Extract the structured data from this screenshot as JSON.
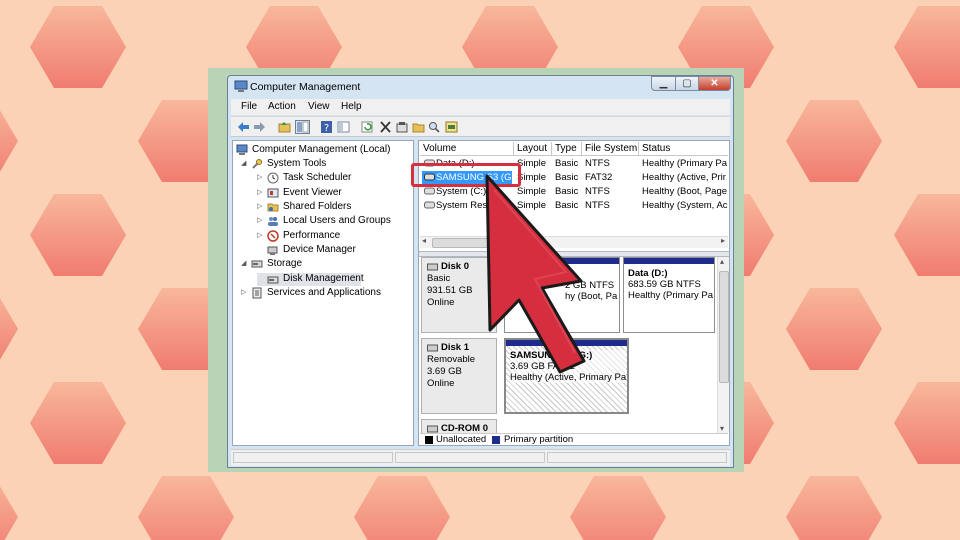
{
  "window": {
    "title": "Computer Management"
  },
  "menu": [
    "File",
    "Action",
    "View",
    "Help"
  ],
  "tree": {
    "root": "Computer Management (Local)",
    "system_tools": "System Tools",
    "items": [
      "Task Scheduler",
      "Event Viewer",
      "Shared Folders",
      "Local Users and Groups",
      "Performance",
      "Device Manager"
    ],
    "storage": "Storage",
    "disk_management": "Disk Management",
    "services": "Services and Applications"
  },
  "volume_table": {
    "columns": [
      "Volume",
      "Layout",
      "Type",
      "File System",
      "Status"
    ],
    "rows": [
      [
        "Data (D:)",
        "Simple",
        "Basic",
        "NTFS",
        "Healthy (Primary Pa"
      ],
      [
        "SAMSUNG S3 (G:)",
        "Simple",
        "Basic",
        "FAT32",
        "Healthy (Active, Prir"
      ],
      [
        "System (C:)",
        "Simple",
        "Basic",
        "NTFS",
        "Healthy (Boot, Page"
      ],
      [
        "System Rese",
        "Simple",
        "Basic",
        "NTFS",
        "Healthy (System, Ac"
      ]
    ]
  },
  "disks": {
    "disk0": {
      "name": "Disk 0",
      "type": "Basic",
      "size": "931.51 GB",
      "state": "Online"
    },
    "disk0_c": {
      "size": "2 GB NTFS",
      "status": "hy (Boot, Pa"
    },
    "disk0_d": {
      "name": "Data  (D:)",
      "size": "683.59 GB NTFS",
      "status": "Healthy (Primary Pa"
    },
    "disk1": {
      "name": "Disk 1",
      "type": "Removable",
      "size": "3.69 GB",
      "state": "Online"
    },
    "disk1_g": {
      "name": "SAMSUNG S3 (G:)",
      "size": "3.69 GB FAT32",
      "status": "Healthy (Active, Primary Pa"
    },
    "cdrom": {
      "name": "CD-ROM 0"
    }
  },
  "legend": {
    "unallocated": "Unallocated",
    "primary": "Primary partition"
  },
  "colors": {
    "accent_red": "#d4303d",
    "primary_partition": "#1e2b8a",
    "selection": "#3399ff"
  }
}
